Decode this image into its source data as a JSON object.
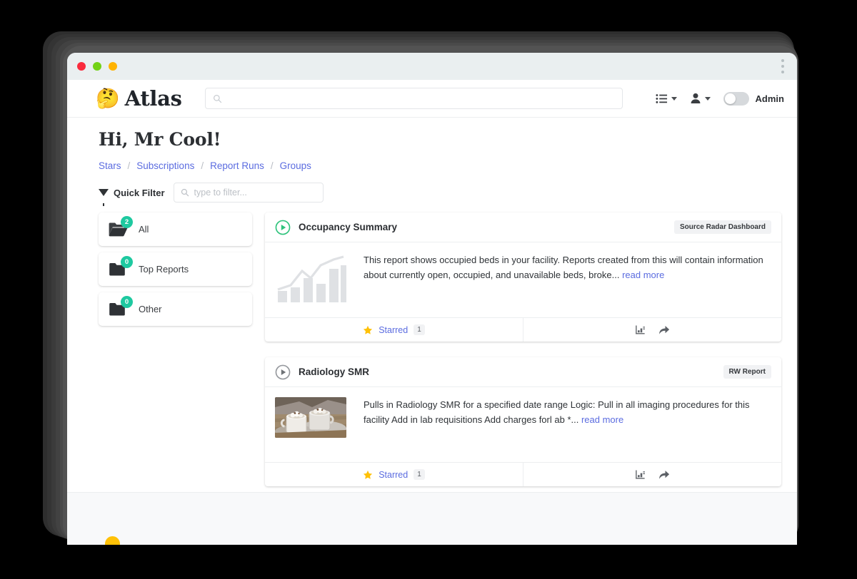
{
  "window": {
    "traffic_lights": [
      "close",
      "minimize",
      "maximize"
    ],
    "menu_icon": "kebab-menu-icon"
  },
  "header": {
    "logo_emoji": "🤔",
    "brand": "Atlas",
    "search": {
      "value": "",
      "placeholder": "",
      "icon": "search-icon"
    },
    "list_menu": {
      "icon": "list-icon",
      "caret": "chevron-down-icon"
    },
    "user_menu": {
      "icon": "user-icon",
      "caret": "chevron-down-icon"
    },
    "admin_toggle": {
      "label": "Admin",
      "state": "off"
    }
  },
  "page": {
    "greeting": "Hi, Mr Cool!",
    "breadcrumb": [
      {
        "label": "Stars"
      },
      {
        "label": "Subscriptions"
      },
      {
        "label": "Report Runs"
      },
      {
        "label": "Groups"
      }
    ],
    "breadcrumb_separator": "/",
    "quick_filter": {
      "label": "Quick Filter",
      "icon": "funnel-icon",
      "input_value": "",
      "input_placeholder": "type to filter..."
    }
  },
  "sidebar": {
    "items": [
      {
        "label": "All",
        "count": "2",
        "icon": "folder-open-icon",
        "selected": true
      },
      {
        "label": "Top Reports",
        "count": "0",
        "icon": "folder-icon",
        "selected": false
      },
      {
        "label": "Other",
        "count": "0",
        "icon": "folder-icon",
        "selected": false
      }
    ]
  },
  "reports": [
    {
      "title": "Occupancy Summary",
      "tag": "Source Radar Dashboard",
      "status_icon": "play-circle-icon",
      "status_color": "#2fc37c",
      "thumbnail": "chart-placeholder-icon",
      "description": "This report shows occupied beds in your facility. Reports created from this will contain information about currently open, occupied, and unavailable beds, broke...",
      "read_more": "read more",
      "starred_label": "Starred",
      "starred_count": "1",
      "star_icon": "star-icon",
      "actions": [
        "chart-icon",
        "share-icon"
      ]
    },
    {
      "title": "Radiology SMR",
      "tag": "RW Report",
      "status_icon": "play-circle-icon",
      "status_color": "#8f9398",
      "thumbnail": "hot-chocolate-photo",
      "description": "Pulls in Radiology SMR for a specified date range Logic: Pull in all imaging procedures for this facility Add in lab requisitions Add charges forl ab *...",
      "read_more": "read more",
      "starred_label": "Starred",
      "starred_count": "1",
      "star_icon": "star-icon",
      "actions": [
        "chart-icon",
        "share-icon"
      ]
    }
  ],
  "colors": {
    "accent_link": "#5b6ce0",
    "badge_teal": "#1ec9a0",
    "star_yellow": "#ffc107",
    "play_green": "#2fc37c",
    "titlebar": "#eaeff0"
  }
}
